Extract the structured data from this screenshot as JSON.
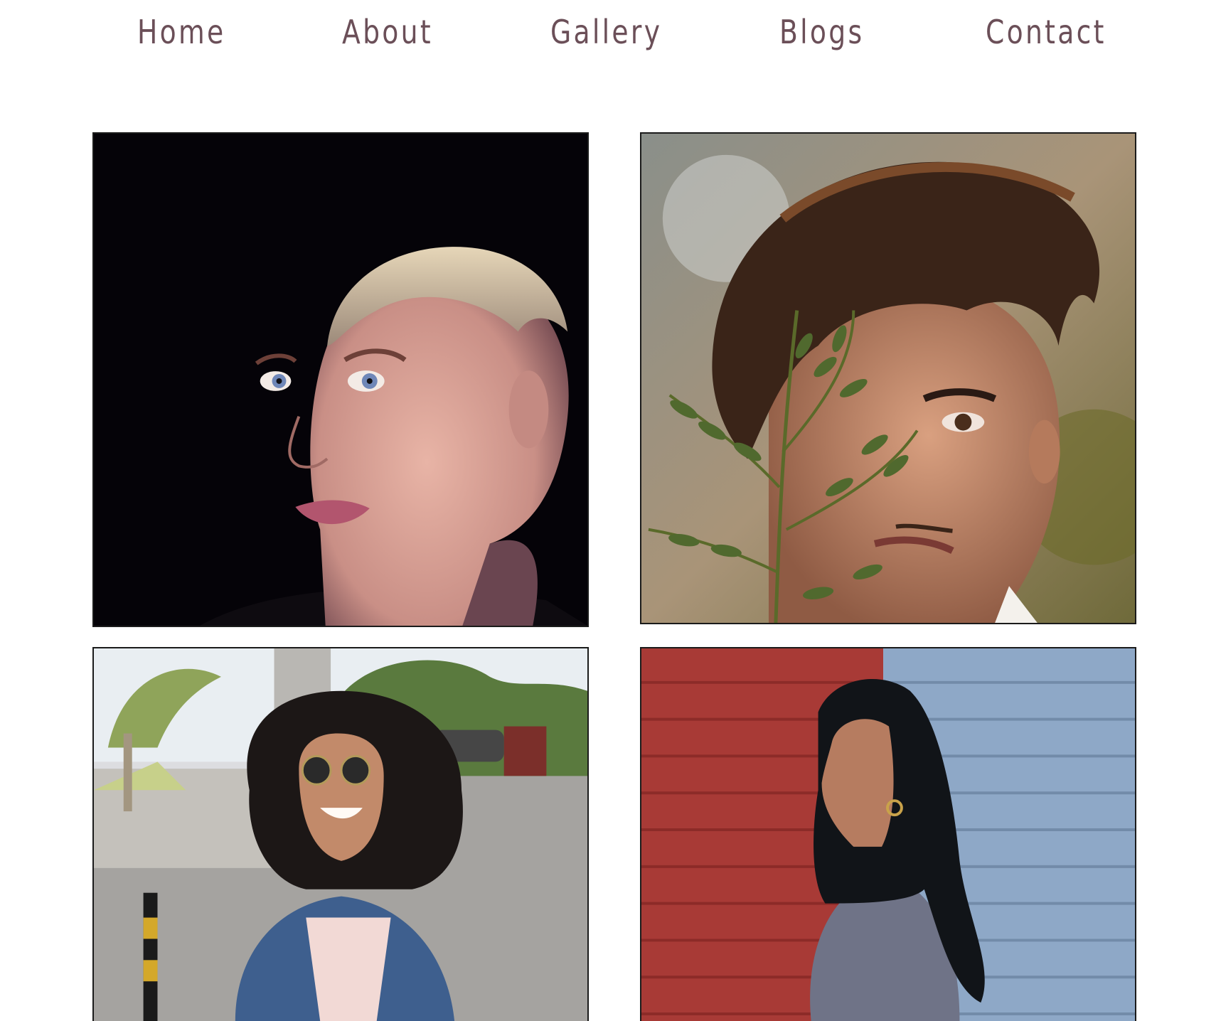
{
  "nav": {
    "items": [
      {
        "label": "Home"
      },
      {
        "label": "About"
      },
      {
        "label": "Gallery"
      },
      {
        "label": "Blogs"
      },
      {
        "label": "Contact"
      }
    ]
  },
  "colors": {
    "nav_text": "#6b4f58",
    "background": "#ffffff",
    "photo_border": "#1b1b1b"
  }
}
